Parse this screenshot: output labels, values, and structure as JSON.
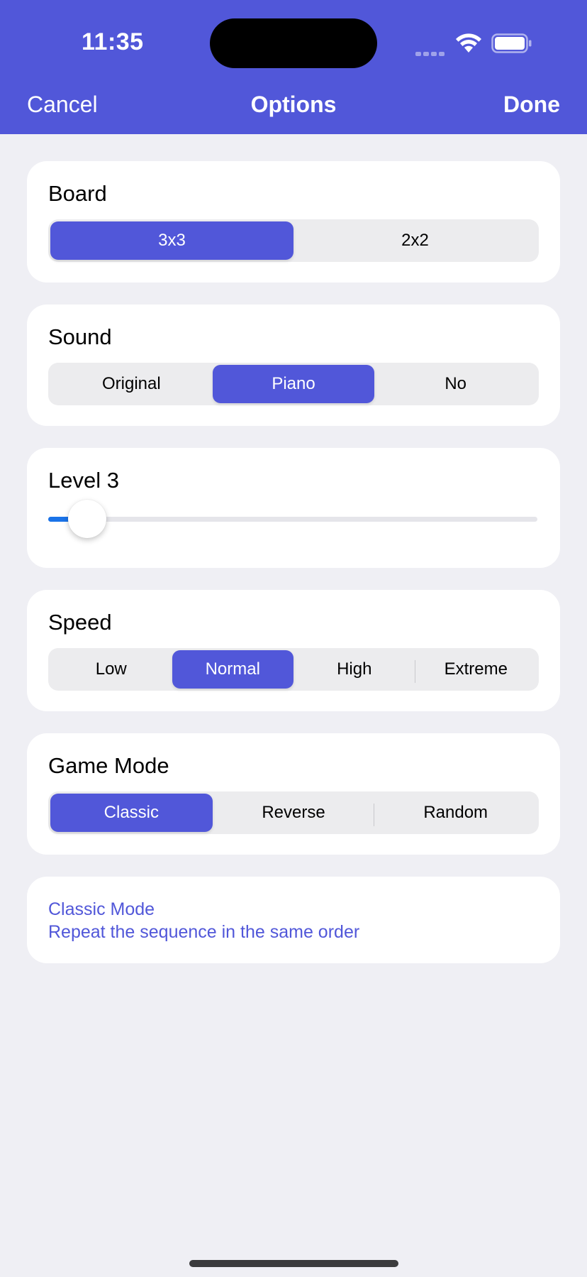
{
  "status_bar": {
    "time": "11:35"
  },
  "nav": {
    "cancel_label": "Cancel",
    "title": "Options",
    "done_label": "Done"
  },
  "board": {
    "title": "Board",
    "options": [
      "3x3",
      "2x2"
    ],
    "selected": "3x3"
  },
  "sound": {
    "title": "Sound",
    "options": [
      "Original",
      "Piano",
      "No"
    ],
    "selected": "Piano"
  },
  "level": {
    "title": "Level 3",
    "slider_fraction": 0.08
  },
  "speed": {
    "title": "Speed",
    "options": [
      "Low",
      "Normal",
      "High",
      "Extreme"
    ],
    "selected": "Normal"
  },
  "game_mode": {
    "title": "Game Mode",
    "options": [
      "Classic",
      "Reverse",
      "Random"
    ],
    "selected": "Classic"
  },
  "description": {
    "mode_name": "Classic Mode",
    "mode_text": "Repeat the sequence in the same order"
  },
  "colors": {
    "accent": "#5157d9",
    "slider_fill": "#1a73e8",
    "background": "#efeff4"
  }
}
